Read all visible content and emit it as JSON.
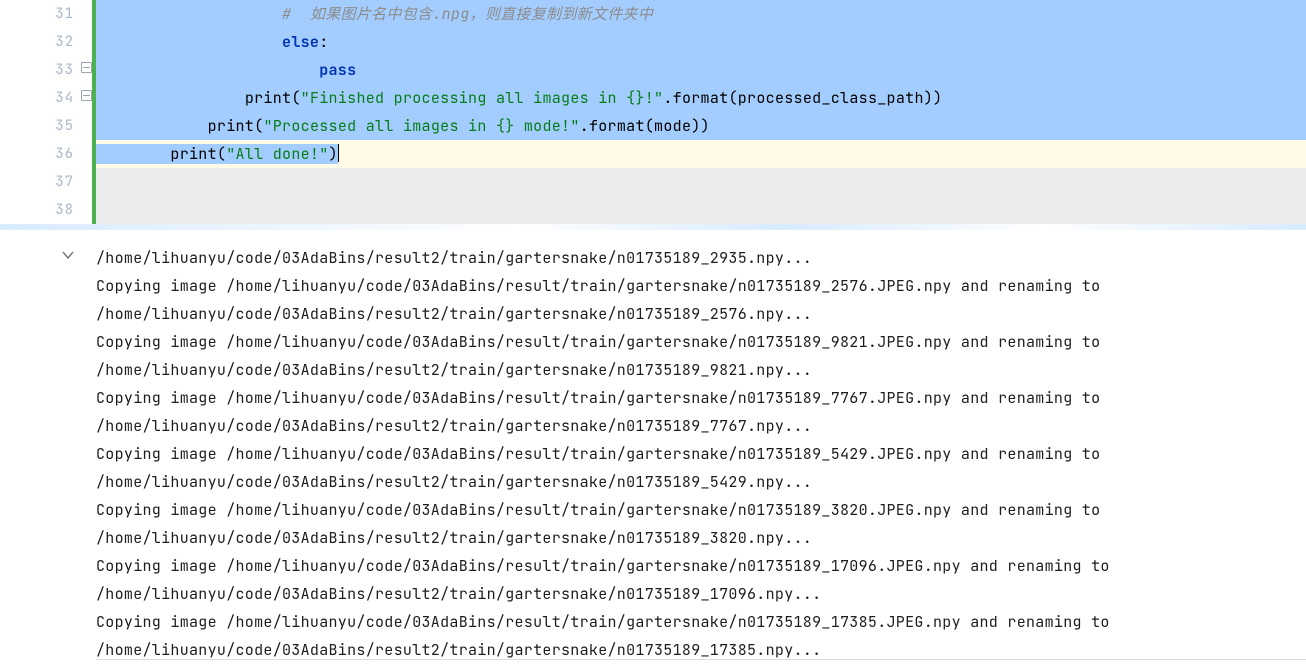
{
  "editor": {
    "line_numbers": [
      "31",
      "32",
      "33",
      "34",
      "35",
      "36",
      "37",
      "38"
    ],
    "lines": {
      "l31_comment": "#  如果图片名中包含.npg，则直接复制到新文件夹中",
      "l32_else": "else",
      "l32_colon": ":",
      "l33_pass": "pass",
      "l34_print": "print",
      "l34_open": "(",
      "l34_str": "\"Finished processing all images in {}!\"",
      "l34_rest": ".format(processed_class_path))",
      "l35_print": "print",
      "l35_open": "(",
      "l35_str": "\"Processed all images in {} mode!\"",
      "l35_rest": ".format(mode))",
      "l36_print": "print",
      "l36_open": "(",
      "l36_str": "\"All done!\"",
      "l36_close": ")"
    },
    "indent": {
      "l31": "                    ",
      "l32": "                    ",
      "l33": "                        ",
      "l34": "                ",
      "l35": "            ",
      "l36": "        "
    }
  },
  "console": [
    "/home/lihuanyu/code/03AdaBins/result2/train/gartersnake/n01735189_2935.npy...",
    "Copying image /home/lihuanyu/code/03AdaBins/result/train/gartersnake/n01735189_2576.JPEG.npy and renaming to",
    "/home/lihuanyu/code/03AdaBins/result2/train/gartersnake/n01735189_2576.npy...",
    "Copying image /home/lihuanyu/code/03AdaBins/result/train/gartersnake/n01735189_9821.JPEG.npy and renaming to",
    "/home/lihuanyu/code/03AdaBins/result2/train/gartersnake/n01735189_9821.npy...",
    "Copying image /home/lihuanyu/code/03AdaBins/result/train/gartersnake/n01735189_7767.JPEG.npy and renaming to",
    "/home/lihuanyu/code/03AdaBins/result2/train/gartersnake/n01735189_7767.npy...",
    "Copying image /home/lihuanyu/code/03AdaBins/result/train/gartersnake/n01735189_5429.JPEG.npy and renaming to",
    "/home/lihuanyu/code/03AdaBins/result2/train/gartersnake/n01735189_5429.npy...",
    "Copying image /home/lihuanyu/code/03AdaBins/result/train/gartersnake/n01735189_3820.JPEG.npy and renaming to",
    "/home/lihuanyu/code/03AdaBins/result2/train/gartersnake/n01735189_3820.npy...",
    "Copying image /home/lihuanyu/code/03AdaBins/result/train/gartersnake/n01735189_17096.JPEG.npy and renaming to",
    "/home/lihuanyu/code/03AdaBins/result2/train/gartersnake/n01735189_17096.npy...",
    "Copying image /home/lihuanyu/code/03AdaBins/result/train/gartersnake/n01735189_17385.JPEG.npy and renaming to",
    "/home/lihuanyu/code/03AdaBins/result2/train/gartersnake/n01735189_17385.npy..."
  ]
}
